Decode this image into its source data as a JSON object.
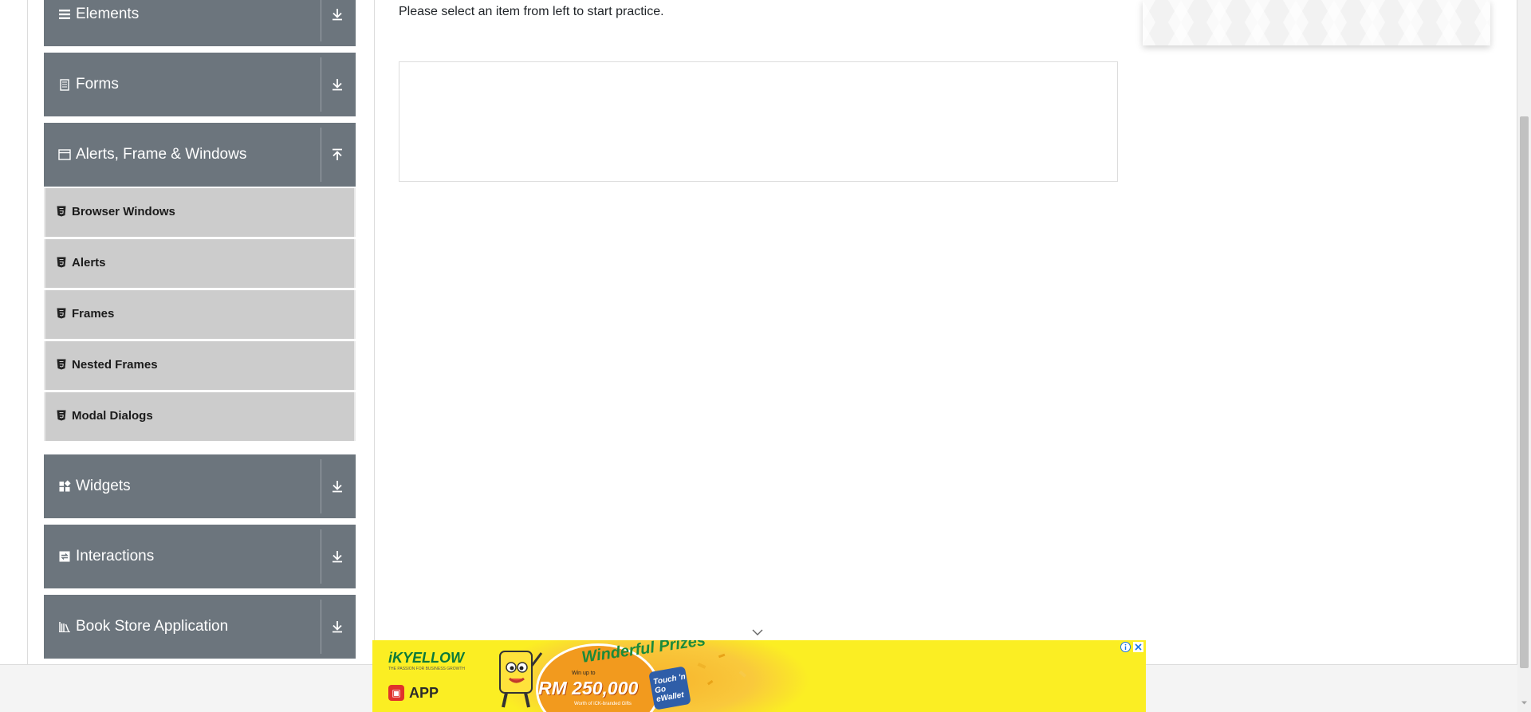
{
  "sidebar": {
    "groups": [
      {
        "label": "Elements",
        "icon": "hamburger-icon",
        "arrow": "download-arrow-icon"
      },
      {
        "label": "Forms",
        "icon": "document-icon",
        "arrow": "download-arrow-icon"
      },
      {
        "label": "Alerts, Frame & Windows",
        "icon": "window-icon",
        "arrow": "upload-arrow-icon"
      },
      {
        "label": "Widgets",
        "icon": "widgets-icon",
        "arrow": "download-arrow-icon"
      },
      {
        "label": "Interactions",
        "icon": "interactions-icon",
        "arrow": "download-arrow-icon"
      },
      {
        "label": "Book Store Application",
        "icon": "books-icon",
        "arrow": "download-arrow-icon"
      }
    ],
    "menu_items": [
      {
        "label": "Browser Windows",
        "icon": "html5-icon"
      },
      {
        "label": "Alerts",
        "icon": "html5-icon"
      },
      {
        "label": "Frames",
        "icon": "html5-icon"
      },
      {
        "label": "Nested Frames",
        "icon": "html5-icon"
      },
      {
        "label": "Modal Dialogs",
        "icon": "html5-icon"
      }
    ]
  },
  "main": {
    "intro": "Please select an item from left to start practice."
  },
  "bottom_ad": {
    "brand": "iKYELLOW",
    "brand_tagline": "THE PASSION FOR BUSINESS GROWTH",
    "app_label": "APP",
    "headline": "Winderful Prizes",
    "sub": "Win up to",
    "amount": "RM 250,000",
    "fine_print": "Worth of iCK-branded Gifts",
    "wallet_label": "Touch 'n Go eWallet"
  },
  "colors": {
    "sidebar_group_bg": "#6c757d",
    "menu_item_bg": "#cccccc",
    "ad_yellow": "#fbee23"
  }
}
